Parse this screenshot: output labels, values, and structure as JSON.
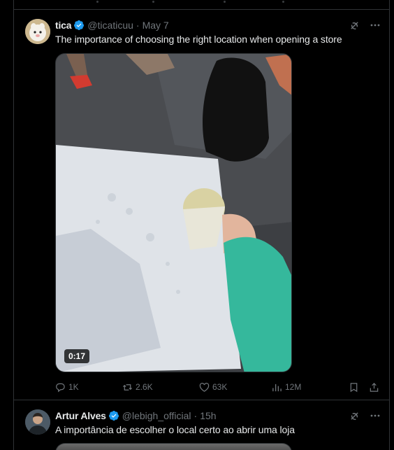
{
  "colors": {
    "background": "#000000",
    "text": "#e7e9ea",
    "muted": "#71767b",
    "border": "#2f3336",
    "verified": "#1d9bf0"
  },
  "tweets": [
    {
      "author_name": "tica",
      "handle": "@ticaticuu",
      "separator": "·",
      "time": "May 7",
      "verified_icon": "verified-badge-icon",
      "text": "The importance of choosing the right location when opening a store",
      "media": {
        "type": "video",
        "duration": "0:17"
      },
      "actions": {
        "replies": "1K",
        "reposts": "2.6K",
        "likes": "63K",
        "views": "12M"
      }
    },
    {
      "author_name": "Artur Alves",
      "handle": "@lebigh_official",
      "separator": "·",
      "time": "15h",
      "verified_icon": "verified-badge-icon",
      "text": "A importância de escolher o local certo ao abrir uma loja"
    }
  ],
  "icons": [
    "grok-icon",
    "more-icon",
    "reply-icon",
    "repost-icon",
    "like-icon",
    "views-icon",
    "bookmark-icon",
    "share-icon"
  ]
}
